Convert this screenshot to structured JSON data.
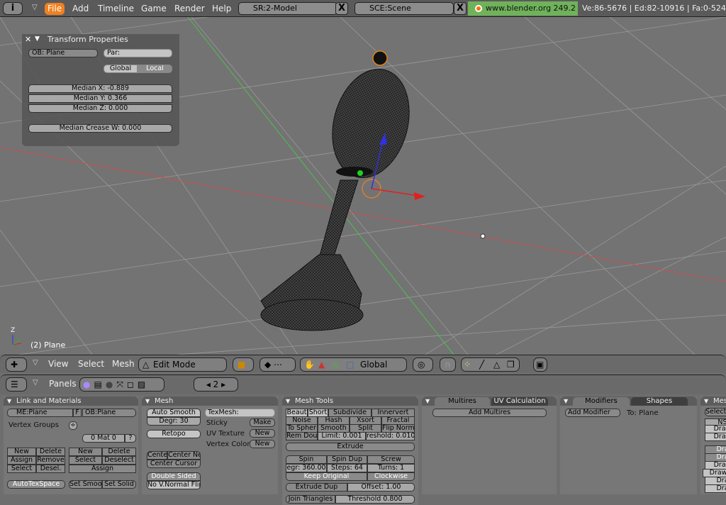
{
  "topbar": {
    "menus": [
      "File",
      "Add",
      "Timeline",
      "Game",
      "Render",
      "Help"
    ],
    "screen": "SR:2-Model",
    "scene": "SCE:Scene",
    "version": "www.blender.org 249.2",
    "stats": "Ve:86-5676 | Ed:82-10916 | Fa:0-524"
  },
  "transform": {
    "title": "Transform Properties",
    "ob": "OB: Plane",
    "par": "Par:",
    "global": "Global",
    "local": "Local",
    "mx": "Median X: -0.889",
    "my": "Median Y: 0.366",
    "mz": "Median Z: 0.000",
    "crease": "Median Crease W: 0.000"
  },
  "viewport": {
    "object_label": "(2) Plane",
    "axis_label": "Z",
    "colors": {
      "x_axis": "#d04040",
      "y_axis": "#40c040",
      "grid": "#9a9a9a"
    }
  },
  "view_header": {
    "menus": [
      "View",
      "Select",
      "Mesh"
    ],
    "mode": "Edit Mode",
    "orientation": "Global"
  },
  "buttons_header": {
    "label": "Panels",
    "page": "2"
  },
  "link": {
    "title": "Link and Materials",
    "me": "ME:Plane",
    "f": "F",
    "ob": "OB:Plane",
    "vgroups": "Vertex Groups",
    "mat": "0 Mat 0",
    "q": "?",
    "left": [
      "New",
      "Delete",
      "Assign",
      "Remove",
      "Select",
      "Desel."
    ],
    "right": [
      "New",
      "Delete",
      "Select",
      "Deselect"
    ],
    "assign": "Assign",
    "autotex": "AutoTexSpace",
    "setsmoo": "Set Smoo",
    "setsolid": "Set Solid"
  },
  "mesh": {
    "title": "Mesh",
    "autosmooth": "Auto Smooth",
    "degr": "Degr: 30",
    "retopo": "Retopo",
    "cente": "Cente",
    "centerne": "Center Ne",
    "centercursor": "Center Cursor",
    "doublesided": "Double Sided",
    "novnormal": "No V.Normal Flip",
    "texmesh": "TexMesh:",
    "sticky": "Sticky",
    "make": "Make",
    "uvtex": "UV Texture",
    "new1": "New",
    "vcol": "Vertex Color",
    "new2": "New"
  },
  "tools": {
    "title": "Mesh Tools",
    "row1": [
      "Beaut",
      "Short",
      "Subdivide",
      "Innervert"
    ],
    "row2": [
      "Noise",
      "Hash",
      "Xsort",
      "Fractal"
    ],
    "row3": [
      "To Spher",
      "Smooth",
      "Split",
      "Flip Norm"
    ],
    "row4": [
      "Rem Dou",
      "Limit: 0.001",
      "reshold: 0.010"
    ],
    "extrude": "Extrude",
    "spin": [
      "Spin",
      "Spin Dup",
      "Screw"
    ],
    "spinv": [
      "egr: 360.00",
      "Steps: 64",
      "Turns: 1"
    ],
    "keep": "Keep Original",
    "clockwise": "Clockwise",
    "extdup": "Extrude Dup",
    "offset": "Offset: 1.00",
    "join": "Join Triangles",
    "threshold": "Threshold 0.800"
  },
  "multires": {
    "tab1": "Multires",
    "tab2": "UV Calculation",
    "add": "Add Multires"
  },
  "modifiers": {
    "tab1": "Modifiers",
    "tab2": "Shapes",
    "add": "Add Modifier",
    "to": "To: Plane"
  },
  "more": {
    "title": "Mes",
    "select": "Select",
    "items": [
      "NS",
      "Draw",
      "Draw",
      "Dra",
      "Dra",
      "Draw",
      "Draw I",
      "Dra",
      "Dra"
    ]
  }
}
